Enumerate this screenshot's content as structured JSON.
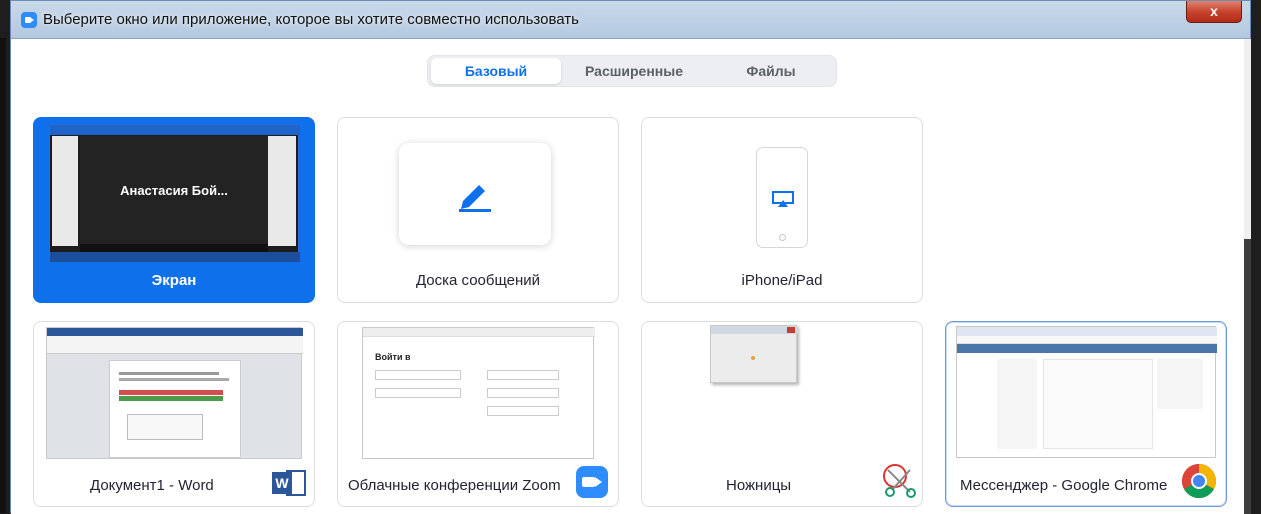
{
  "window": {
    "title": "Выберите окно или приложение, которое вы хотите совместно использовать",
    "close_label": "x"
  },
  "tabs": [
    {
      "label": "Базовый",
      "active": true
    },
    {
      "label": "Расширенные",
      "active": false
    },
    {
      "label": "Файлы",
      "active": false
    }
  ],
  "basic_options": [
    {
      "label": "Экран",
      "preview_text": "Анастасия Бой...",
      "selected": true
    },
    {
      "label": "Доска сообщений",
      "icon": "pencil-icon"
    },
    {
      "label": "iPhone/iPad",
      "icon": "airplay-icon"
    }
  ],
  "windows": [
    {
      "label": "Документ1 - Word",
      "icon": "word-icon",
      "icon_text": "W"
    },
    {
      "label": "Облачные конференции Zoom",
      "icon": "zoom-icon",
      "preview_heading": "Войти в"
    },
    {
      "label": "Ножницы",
      "icon": "scissors-icon"
    },
    {
      "label": "Мессенджер - Google Chrome",
      "icon": "chrome-icon"
    }
  ],
  "colors": {
    "accent": "#0e71eb",
    "word": "#2b579a",
    "zoom": "#2d8cff"
  }
}
